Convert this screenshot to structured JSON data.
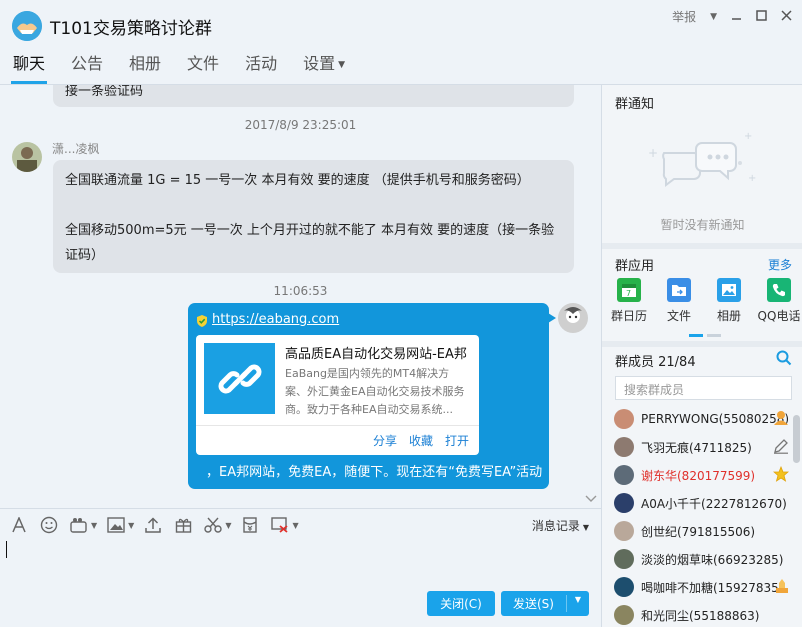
{
  "window": {
    "title": "T101交易策略讨论群",
    "report_label": "举报"
  },
  "tabs": [
    {
      "label": "聊天"
    },
    {
      "label": "公告"
    },
    {
      "label": "相册"
    },
    {
      "label": "文件"
    },
    {
      "label": "活动"
    },
    {
      "label": "设置"
    }
  ],
  "chat": {
    "cut_message_tail": "接一条验证码",
    "timestamp_1": "2017/8/9 23:25:01",
    "sender_1": "潇...凌枫",
    "message_1_line_1": "全国联通流量 1G = 15 一号一次 本月有效 要的速度 （提供手机号和服务密码）",
    "message_1_line_2": "全国移动500m=5元 一号一次 上个月开过的就不能了 本月有效 要的速度（接一条验",
    "message_1_line_3": "证码）",
    "timestamp_2": "11:06:53",
    "link_url": "https://eabang.com",
    "card_title": "高品质EA自动化交易网站-EA邦",
    "card_desc": "EaBang是国内领先的MT4解决方案、外汇黄金EA自动化交易技术服务商。致力于各种EA自动交易系统...",
    "card_share": "分享",
    "card_fav": "收藏",
    "card_open": "打开",
    "blue_tail_text": "，EA邦网站，免费EA，随便下。现在还有“免费写EA”活动"
  },
  "input": {
    "history_label": "消息记录",
    "close_label": "关闭(C)",
    "send_label": "发送(S)"
  },
  "right_panel": {
    "notice_title": "群通知",
    "notice_empty": "暂时没有新通知",
    "apps_title": "群应用",
    "apps_more": "更多",
    "apps": [
      {
        "label": "群日历",
        "color": "#27b24a",
        "icon": "calendar-icon"
      },
      {
        "label": "文件",
        "color": "#3a8ee6",
        "icon": "folder-icon"
      },
      {
        "label": "相册",
        "color": "#2aa0e8",
        "icon": "photo-icon"
      },
      {
        "label": "QQ电话",
        "color": "#18b575",
        "icon": "phone-icon"
      }
    ],
    "members_title": "群成员 21/84",
    "search_placeholder": "搜索群成员",
    "members": [
      {
        "name": "PERRYWONG(55080258)",
        "color": "#c98d74",
        "red": false,
        "badge": "admin-icon"
      },
      {
        "name": "飞羽无痕(4711825)",
        "color": "#8d7a70",
        "red": false,
        "badge": "edit-icon"
      },
      {
        "name": "谢东华(820177599)",
        "color": "#5d6b78",
        "red": true,
        "badge": "star-icon"
      },
      {
        "name": "A0A小千千(2227812670)",
        "color": "#2b3f6a",
        "red": false,
        "badge": ""
      },
      {
        "name": "创世纪(791815506)",
        "color": "#b9a89a",
        "red": false,
        "badge": ""
      },
      {
        "name": "淡淡的烟草味(66923285)",
        "color": "#606c5c",
        "red": false,
        "badge": ""
      },
      {
        "name": "喝咖啡不加糖(15927835",
        "color": "#1d4e6e",
        "red": false,
        "badge": "level-icon"
      },
      {
        "name": "和光同尘(55188863)",
        "color": "#8a8560",
        "red": false,
        "badge": ""
      }
    ]
  }
}
